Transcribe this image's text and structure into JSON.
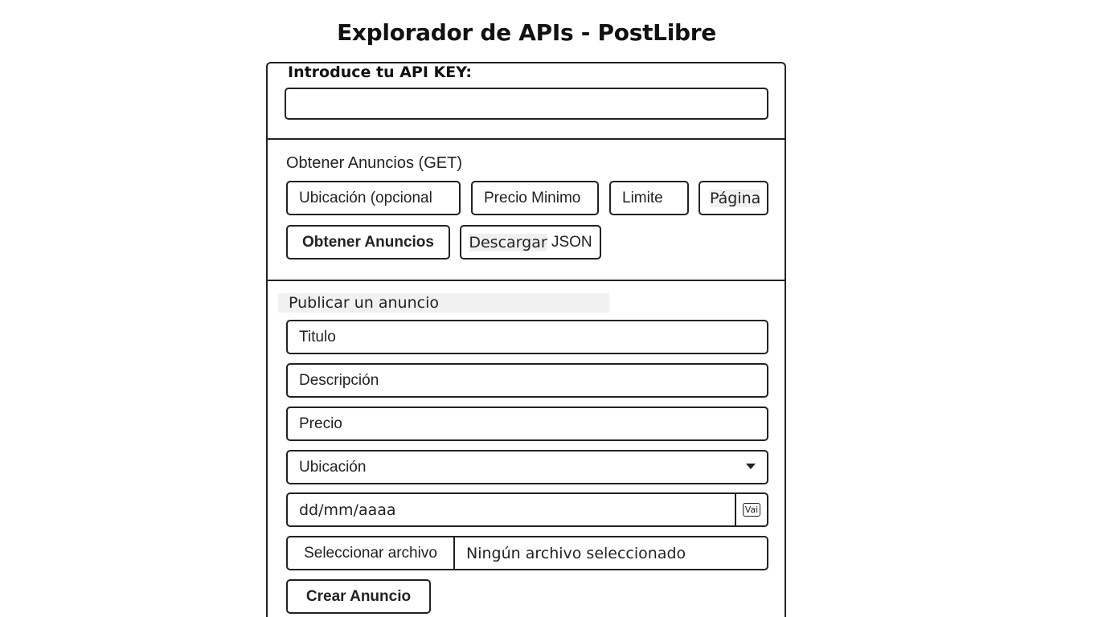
{
  "page": {
    "title": "Explorador de APIs - PostLibre"
  },
  "api_key": {
    "label": "Introduce tu API KEY:",
    "value": ""
  },
  "get_section": {
    "title": "Obtener Anuncios (GET)",
    "fields": {
      "ubicacion": "Ubicación (opcional",
      "precio_minimo": "Precio Minimo",
      "limite": "Limite",
      "pagina": "Página"
    },
    "buttons": {
      "obtener": "Obtener Anuncios",
      "descargar_part1": "Descargar",
      "descargar_part2": " JSON"
    }
  },
  "post_section": {
    "title": "Publicar un anuncio",
    "fields": {
      "titulo": "Titulo",
      "descripcion": "Descripción",
      "precio": "Precio",
      "ubicacion": "Ubicación",
      "fecha": "dd/mm/aaaa",
      "fecha_button": "Vai"
    },
    "file": {
      "button": "Seleccionar archivo",
      "status": "Ningún archivo seleccionado"
    },
    "submit": "Crear Anuncio"
  },
  "icons": {
    "dropdown": "chevron-down-icon",
    "calendar": "calendar-icon"
  }
}
